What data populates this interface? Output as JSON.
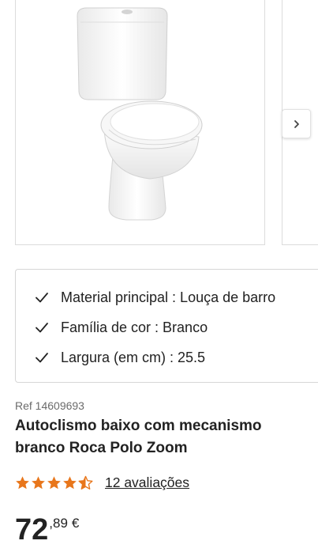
{
  "product": {
    "image_alt": "toilet-image",
    "features": [
      {
        "text": "Material principal : Louça de barro"
      },
      {
        "text": "Família de cor : Branco"
      },
      {
        "text": "Largura (em cm) : 25.5"
      }
    ],
    "ref": "Ref 14609693",
    "title": "Autoclismo baixo com mecanismo branco Roca Polo Zoom",
    "rating": {
      "stars": 4.5,
      "max": 5,
      "reviews_label": "12 avaliações"
    },
    "price": {
      "integer": "72",
      "decimal": ",89",
      "currency": "€"
    }
  },
  "colors": {
    "star": "#e8761b",
    "text": "#222222",
    "border": "#d6d6d6"
  },
  "icons": {
    "next": "chevron-right-icon",
    "check": "check-icon",
    "star": "star-icon"
  }
}
